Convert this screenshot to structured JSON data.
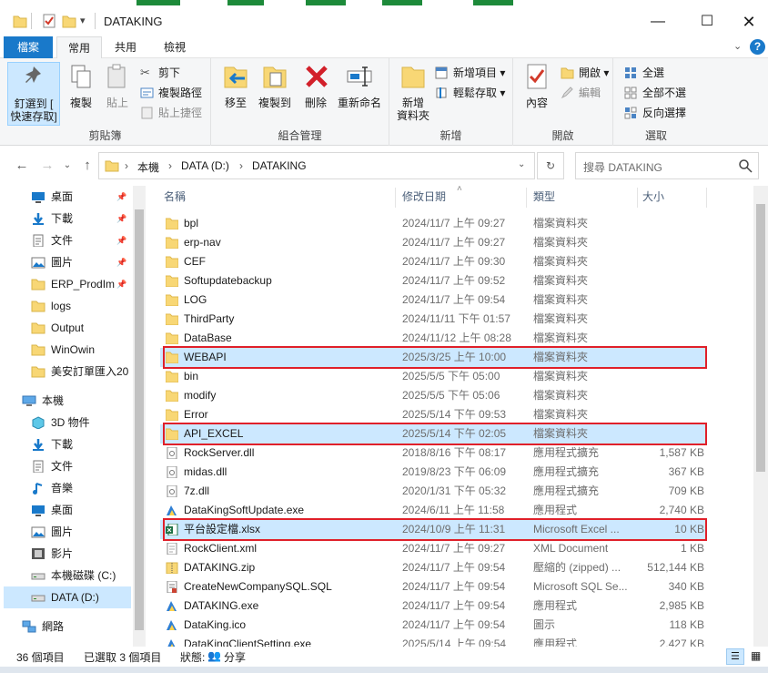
{
  "window": {
    "title": "DATAKING"
  },
  "tabs": [
    "檔案",
    "常用",
    "共用",
    "檢視"
  ],
  "ribbon": {
    "clipboard": {
      "label": "剪貼簿",
      "pin": "釘選到 [\n快速存取]",
      "copy": "複製",
      "paste": "貼上",
      "cut": "剪下",
      "copy_path": "複製路徑",
      "paste_shortcut": "貼上捷徑"
    },
    "organize": {
      "label": "組合管理",
      "move_to": "移至",
      "copy_to": "複製到",
      "delete": "刪除",
      "rename": "重新命名"
    },
    "new": {
      "label": "新增",
      "new_folder": "新增\n資料夾",
      "new_item": "新增項目 ▾",
      "easy_access": "輕鬆存取 ▾"
    },
    "open": {
      "label": "開啟",
      "properties": "內容",
      "open": "開啟 ▾",
      "edit": "編輯"
    },
    "select": {
      "label": "選取",
      "select_all": "全選",
      "select_none": "全部不選",
      "invert": "反向選擇"
    }
  },
  "address": {
    "crumbs": [
      "本機",
      "DATA (D:)",
      "DATAKING"
    ],
    "search_placeholder": "搜尋 DATAKING"
  },
  "nav": [
    {
      "label": "桌面",
      "pinned": true,
      "icon": "desktop-icon"
    },
    {
      "label": "下載",
      "pinned": true,
      "icon": "download-icon"
    },
    {
      "label": "文件",
      "pinned": true,
      "icon": "document-icon"
    },
    {
      "label": "圖片",
      "pinned": true,
      "icon": "picture-icon"
    },
    {
      "label": "ERP_ProdIm",
      "pinned": true,
      "icon": "folder-icon"
    },
    {
      "label": "logs",
      "pinned": false,
      "icon": "folder-icon"
    },
    {
      "label": "Output",
      "pinned": false,
      "icon": "folder-icon"
    },
    {
      "label": "WinOwin",
      "pinned": false,
      "icon": "folder-icon"
    },
    {
      "label": "美安訂單匯入20",
      "pinned": false,
      "icon": "folder-icon"
    },
    {
      "label": "本機",
      "pinned": false,
      "icon": "computer-icon"
    },
    {
      "label": "3D 物件",
      "pinned": false,
      "icon": "3d-objects-icon"
    },
    {
      "label": "下載",
      "pinned": false,
      "icon": "download-icon"
    },
    {
      "label": "文件",
      "pinned": false,
      "icon": "document-icon"
    },
    {
      "label": "音樂",
      "pinned": false,
      "icon": "music-icon"
    },
    {
      "label": "桌面",
      "pinned": false,
      "icon": "desktop-icon"
    },
    {
      "label": "圖片",
      "pinned": false,
      "icon": "picture-icon"
    },
    {
      "label": "影片",
      "pinned": false,
      "icon": "video-icon"
    },
    {
      "label": "本機磁碟 (C:)",
      "pinned": false,
      "icon": "drive-icon"
    },
    {
      "label": "DATA (D:)",
      "pinned": false,
      "icon": "drive-icon"
    },
    {
      "label": "網路",
      "pinned": false,
      "icon": "network-icon"
    }
  ],
  "columns": {
    "name": "名稱",
    "date": "修改日期",
    "type": "類型",
    "size": "大小"
  },
  "files": [
    {
      "name": "bpl",
      "date": "2024/11/7 上午 09:27",
      "type": "檔案資料夾",
      "size": "",
      "icon": "folder"
    },
    {
      "name": "erp-nav",
      "date": "2024/11/7 上午 09:27",
      "type": "檔案資料夾",
      "size": "",
      "icon": "folder"
    },
    {
      "name": "CEF",
      "date": "2024/11/7 上午 09:30",
      "type": "檔案資料夾",
      "size": "",
      "icon": "folder"
    },
    {
      "name": "Softupdatebackup",
      "date": "2024/11/7 上午 09:52",
      "type": "檔案資料夾",
      "size": "",
      "icon": "folder"
    },
    {
      "name": "LOG",
      "date": "2024/11/7 上午 09:54",
      "type": "檔案資料夾",
      "size": "",
      "icon": "folder"
    },
    {
      "name": "ThirdParty",
      "date": "2024/11/11 下午 01:57",
      "type": "檔案資料夾",
      "size": "",
      "icon": "folder"
    },
    {
      "name": "DataBase",
      "date": "2024/11/12 上午 08:28",
      "type": "檔案資料夾",
      "size": "",
      "icon": "folder"
    },
    {
      "name": "WEBAPI",
      "date": "2025/3/25 上午 10:00",
      "type": "檔案資料夾",
      "size": "",
      "icon": "folder",
      "selected": true
    },
    {
      "name": "bin",
      "date": "2025/5/5 下午 05:00",
      "type": "檔案資料夾",
      "size": "",
      "icon": "folder"
    },
    {
      "name": "modify",
      "date": "2025/5/5 下午 05:06",
      "type": "檔案資料夾",
      "size": "",
      "icon": "folder"
    },
    {
      "name": "Error",
      "date": "2025/5/14 下午 09:53",
      "type": "檔案資料夾",
      "size": "",
      "icon": "folder"
    },
    {
      "name": "API_EXCEL",
      "date": "2025/5/14 下午 02:05",
      "type": "檔案資料夾",
      "size": "",
      "icon": "folder",
      "selected": true
    },
    {
      "name": "RockServer.dll",
      "date": "2018/8/16 下午 08:17",
      "type": "應用程式擴充",
      "size": "1,587 KB",
      "icon": "dll"
    },
    {
      "name": "midas.dll",
      "date": "2019/8/23 下午 06:09",
      "type": "應用程式擴充",
      "size": "367 KB",
      "icon": "dll"
    },
    {
      "name": "7z.dll",
      "date": "2020/1/31 下午 05:32",
      "type": "應用程式擴充",
      "size": "709 KB",
      "icon": "dll"
    },
    {
      "name": "DataKingSoftUpdate.exe",
      "date": "2024/6/11 上午 11:58",
      "type": "應用程式",
      "size": "2,740 KB",
      "icon": "exe"
    },
    {
      "name": "平台設定檔.xlsx",
      "date": "2024/10/9 上午 11:31",
      "type": "Microsoft Excel ...",
      "size": "10 KB",
      "icon": "xlsx",
      "selected": true
    },
    {
      "name": "RockClient.xml",
      "date": "2024/11/7 上午 09:27",
      "type": "XML Document",
      "size": "1 KB",
      "icon": "xml"
    },
    {
      "name": "DATAKING.zip",
      "date": "2024/11/7 上午 09:54",
      "type": "壓縮的 (zipped) ...",
      "size": "512,144 KB",
      "icon": "zip"
    },
    {
      "name": "CreateNewCompanySQL.SQL",
      "date": "2024/11/7 上午 09:54",
      "type": "Microsoft SQL Se...",
      "size": "340 KB",
      "icon": "sql"
    },
    {
      "name": "DATAKING.exe",
      "date": "2024/11/7 上午 09:54",
      "type": "應用程式",
      "size": "2,985 KB",
      "icon": "exe"
    },
    {
      "name": "DataKing.ico",
      "date": "2024/11/7 上午 09:54",
      "type": "圖示",
      "size": "118 KB",
      "icon": "ico"
    },
    {
      "name": "DataKingClientSetting.exe",
      "date": "2025/5/14 上午 09:54",
      "type": "應用程式",
      "size": "2,427 KB",
      "icon": "exe"
    }
  ],
  "status": {
    "count": "36 個項目",
    "selected": "已選取 3 個項目",
    "state_label": "狀態:",
    "state_value": "分享"
  },
  "colors": {
    "accent": "#1979ca",
    "selection": "#cce8ff",
    "highlight_box": "#e0202a",
    "folder": "#f8d775"
  }
}
